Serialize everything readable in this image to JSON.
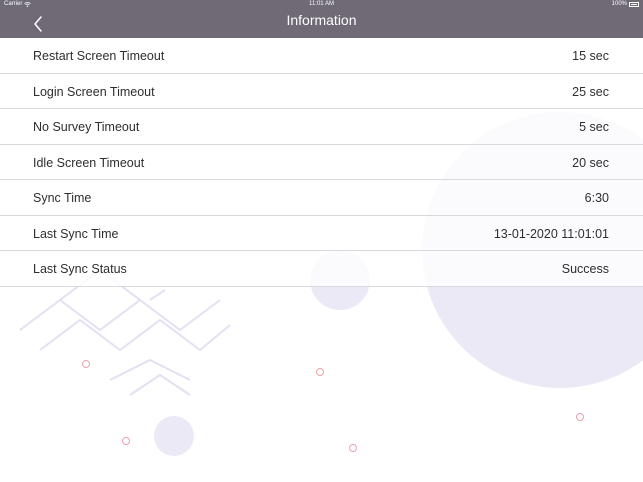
{
  "status_bar": {
    "carrier": "Carrier",
    "time": "11:01 AM",
    "battery": "100%"
  },
  "nav": {
    "title": "Information",
    "back_icon": "chevron-left-icon"
  },
  "rows": [
    {
      "label": "Restart Screen Timeout",
      "value": "15 sec"
    },
    {
      "label": "Login Screen Timeout",
      "value": "25 sec"
    },
    {
      "label": "No Survey Timeout",
      "value": "5 sec"
    },
    {
      "label": "Idle Screen Timeout",
      "value": "20 sec"
    },
    {
      "label": "Sync Time",
      "value": "6:30"
    },
    {
      "label": "Last Sync Time",
      "value": "13-01-2020 11:01:01"
    },
    {
      "label": "Last Sync Status",
      "value": "Success"
    }
  ],
  "colors": {
    "nav_background": "#6f6a75",
    "decor_circle": "#ece9f6",
    "decor_ring": "#e9a1ad",
    "decor_lines": "#ece9f5"
  }
}
